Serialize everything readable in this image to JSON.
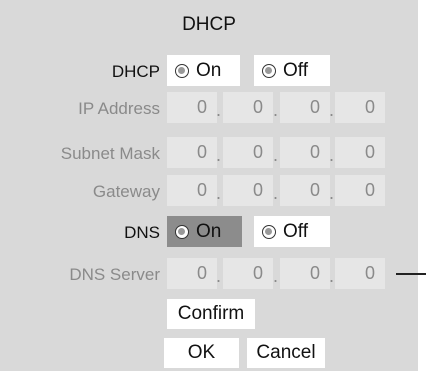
{
  "title": "DHCP",
  "dhcp": {
    "label": "DHCP",
    "options": [
      {
        "label": "On",
        "selected": false
      },
      {
        "label": "Off",
        "selected": false
      }
    ]
  },
  "ip_address": {
    "label": "IP Address",
    "octets": [
      "0",
      "0",
      "0",
      "0"
    ]
  },
  "subnet_mask": {
    "label": "Subnet Mask",
    "octets": [
      "0",
      "0",
      "0",
      "0"
    ]
  },
  "gateway": {
    "label": "Gateway",
    "octets": [
      "0",
      "0",
      "0",
      "0"
    ]
  },
  "dns": {
    "label": "DNS",
    "options": [
      {
        "label": "On",
        "selected": true
      },
      {
        "label": "Off",
        "selected": false
      }
    ]
  },
  "dns_server": {
    "label": "DNS Server",
    "octets": [
      "0",
      "0",
      "0",
      "0"
    ]
  },
  "separator": ".",
  "buttons": {
    "confirm": "Confirm",
    "ok": "OK",
    "cancel": "Cancel"
  },
  "colors": {
    "panel": "#d9d9d9",
    "field": "#e6e6e6",
    "selected": "#8c8c8c",
    "disabled_text": "#8a8a8a"
  }
}
